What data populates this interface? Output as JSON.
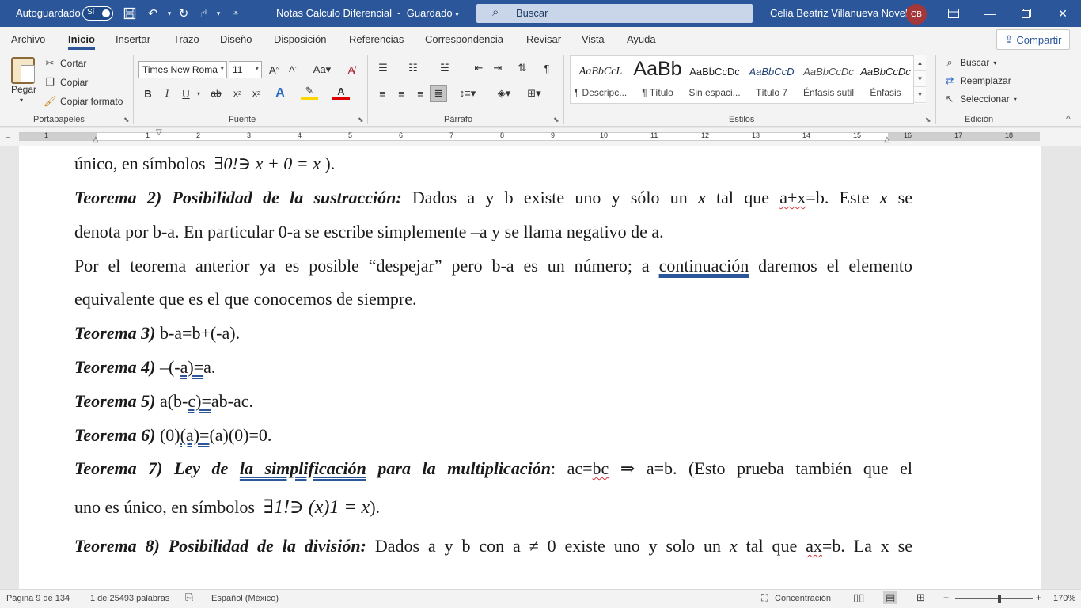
{
  "titlebar": {
    "autosave_label": "Autoguardado",
    "autosave_state": "Sí",
    "doc_title": "Notas Calculo Diferencial",
    "doc_status": "Guardado",
    "search_placeholder": "Buscar",
    "user_name": "Celia Beatriz Villanueva Novelo",
    "user_initials": "CB"
  },
  "tabs": [
    "Archivo",
    "Inicio",
    "Insertar",
    "Trazo",
    "Diseño",
    "Disposición",
    "Referencias",
    "Correspondencia",
    "Revisar",
    "Vista",
    "Ayuda"
  ],
  "share_label": "Compartir",
  "clipboard": {
    "paste": "Pegar",
    "cut": "Cortar",
    "copy": "Copiar",
    "format_painter": "Copiar formato",
    "group": "Portapapeles"
  },
  "font": {
    "name": "Times New Roma",
    "size": "11",
    "group": "Fuente"
  },
  "paragraph": {
    "group": "Párrafo"
  },
  "styles": {
    "group": "Estilos",
    "items": [
      {
        "preview": "AaBbCcL",
        "name": "¶ Descripc..."
      },
      {
        "preview": "AaBb",
        "name": "¶ Título"
      },
      {
        "preview": "AaBbCcDc",
        "name": "Sin espaci..."
      },
      {
        "preview": "AaBbCcD",
        "name": "Título 7"
      },
      {
        "preview": "AaBbCcDc",
        "name": "Énfasis sutil"
      },
      {
        "preview": "AaBbCcDc",
        "name": "Énfasis"
      }
    ]
  },
  "editing": {
    "find": "Buscar",
    "replace": "Reemplazar",
    "select": "Seleccionar",
    "group": "Edición"
  },
  "ruler_numbers": [
    "1",
    "1",
    "2",
    "3",
    "4",
    "5",
    "6",
    "7",
    "8",
    "9",
    "10",
    "11",
    "12",
    "13",
    "14",
    "15",
    "16",
    "17",
    "18"
  ],
  "document": {
    "l1": "único, en símbolos",
    "l1_math": "∃0!∋ x + 0 = x",
    "l1_end": ").",
    "t2_title": "Teorema 2) Posibilidad de la sustracción:",
    "t2_text_a": "Dados a y b existe uno y sólo un",
    "t2_x": "x",
    "t2_text_b": "tal que",
    "t2_eq_a": "a+x",
    "t2_text_c": "=b. Este",
    "t2_x2": "x",
    "t2_text_d": "se",
    "t2_line2": "denota por b-a. En particular 0-a se escribe simplemente –a y se llama negativo de a.",
    "p_a": "Por el teorema anterior ya es posible “despejar” pero b-a es un número; a",
    "p_link": "continuación",
    "p_b": "daremos el elemento",
    "p_line2": "equivalente que es el que conocemos de siempre.",
    "t3_title": "Teorema 3)",
    "t3_text": "b-a=b+(-a).",
    "t4_title": "Teorema 4)",
    "t4_a": "–(-",
    "t4_u": "a)=",
    "t4_b": "a.",
    "t5_title": "Teorema 5)",
    "t5_a": "a(b-",
    "t5_u": "c)=",
    "t5_b": "ab-ac.",
    "t6_title": "Teorema 6)",
    "t6_a": "(0)",
    "t6_u": "(a)=",
    "t6_b": "(a)(0)=0.",
    "t7_title_a": "Teorema 7) Ley de",
    "t7_title_u": "la  simplificación",
    "t7_title_b": "para la multiplicación",
    "t7_colon": ":",
    "t7_a": "ac=",
    "t7_sq": "bc",
    "t7_arrow": "⇒",
    "t7_b": "a=b. (Esto prueba también que el",
    "t7_line2": "uno es único, en símbolos",
    "t7_math": "∃1!∋ (x)1 = x",
    "t7_end": ").",
    "t8_title": "Teorema 8) Posibilidad de la división:",
    "t8_a": "Dados a y b con a ≠ 0 existe uno y solo un",
    "t8_x": "x",
    "t8_b": "tal que",
    "t8_sq": "ax",
    "t8_c": "=b. La x se"
  },
  "statusbar": {
    "page": "Página 9 de 134",
    "words": "1 de 25493 palabras",
    "language": "Español (México)",
    "focus": "Concentración",
    "zoom": "170%"
  }
}
